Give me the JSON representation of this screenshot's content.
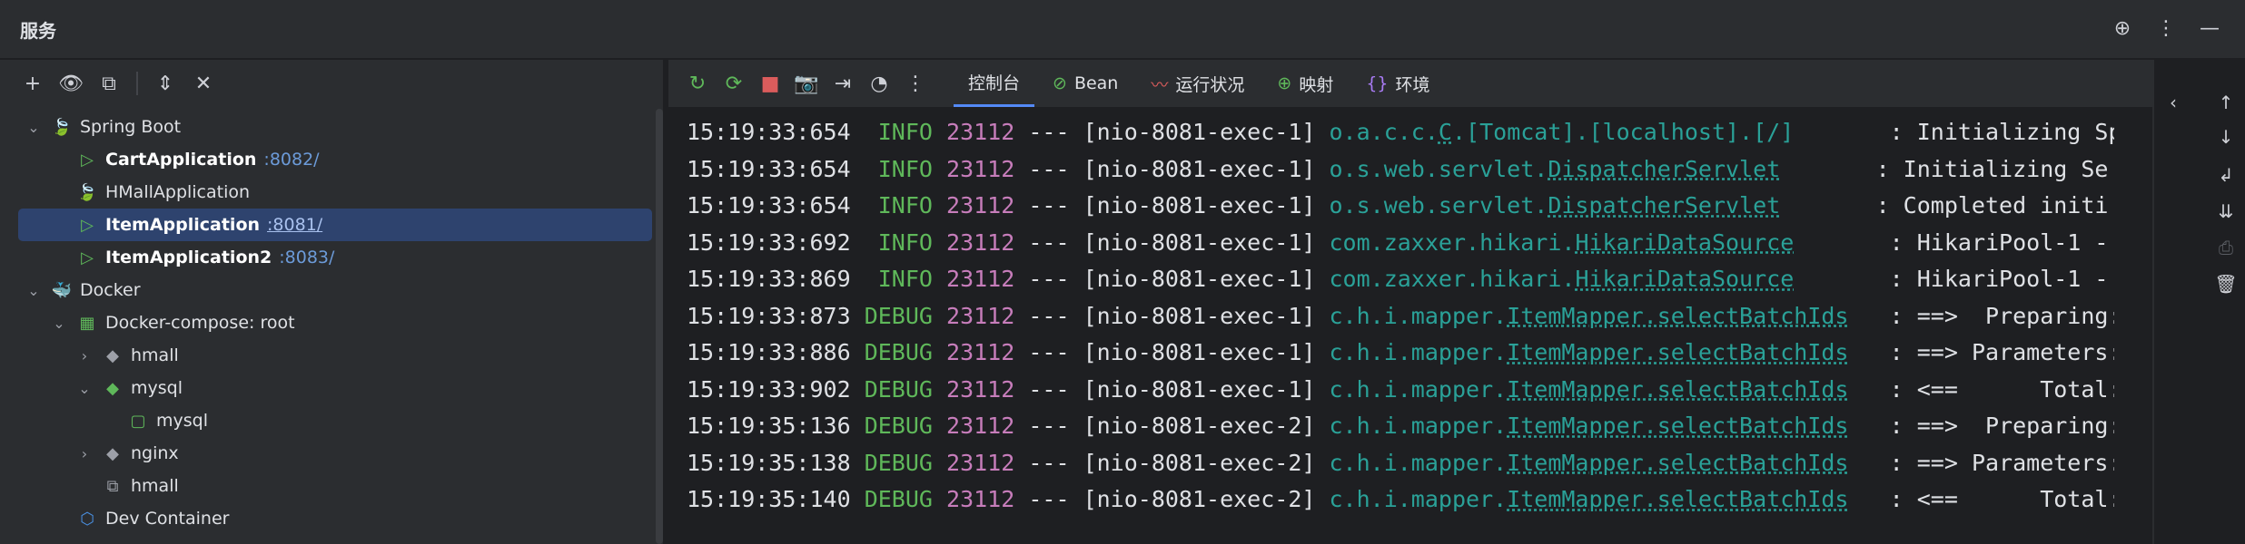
{
  "window": {
    "title": "服务"
  },
  "title_tools": [
    {
      "name": "target-icon",
      "glyph": "⊕"
    },
    {
      "name": "more-vertical-icon",
      "glyph": "⋮"
    },
    {
      "name": "minimize-icon",
      "glyph": "—"
    }
  ],
  "left_toolbar": [
    {
      "name": "add-icon",
      "glyph": "+"
    },
    {
      "name": "eye-icon",
      "glyph": "👁"
    },
    {
      "name": "new-tab-icon",
      "glyph": "⧉"
    },
    {
      "name": "expand-all-icon",
      "glyph": "⇕"
    },
    {
      "name": "collapse-all-icon",
      "glyph": "✕"
    }
  ],
  "tree": [
    {
      "label": "Spring Boot",
      "port": "",
      "indent": 0,
      "chevron": "⌄",
      "icon": "spring-boot-icon",
      "glyph": "🍃",
      "color": "#5fb85a",
      "bold": false,
      "selected": false
    },
    {
      "label": "CartApplication",
      "port": " :8082/",
      "indent": 1,
      "chevron": "",
      "icon": "run-icon",
      "glyph": "▷",
      "color": "#5fb85a",
      "bold": true,
      "selected": false
    },
    {
      "label": "HMallApplication",
      "port": "",
      "indent": 1,
      "chevron": "",
      "icon": "spring-boot-icon",
      "glyph": "🍃",
      "color": "#5fb85a",
      "bold": false,
      "selected": false
    },
    {
      "label": "ItemApplication",
      "port": " :8081/",
      "indent": 1,
      "chevron": "",
      "icon": "run-icon",
      "glyph": "▷",
      "color": "#5fb85a",
      "bold": true,
      "selected": true
    },
    {
      "label": "ItemApplication2",
      "port": " :8083/",
      "indent": 1,
      "chevron": "",
      "icon": "run-icon",
      "glyph": "▷",
      "color": "#5fb85a",
      "bold": true,
      "selected": false
    },
    {
      "label": "Docker",
      "port": "",
      "indent": 0,
      "chevron": "⌄",
      "icon": "docker-icon",
      "glyph": "🐳",
      "color": "#4a90e2",
      "bold": false,
      "selected": false
    },
    {
      "label": "Docker-compose: root",
      "port": "",
      "indent": 1,
      "chevron": "⌄",
      "icon": "compose-icon",
      "glyph": "▦",
      "color": "#5fb85a",
      "bold": false,
      "selected": false
    },
    {
      "label": "hmall",
      "port": "",
      "indent": 2,
      "chevron": "›",
      "icon": "service-icon",
      "glyph": "◆",
      "color": "#9da0a8",
      "bold": false,
      "selected": false
    },
    {
      "label": "mysql",
      "port": "",
      "indent": 2,
      "chevron": "⌄",
      "icon": "service-icon",
      "glyph": "◆",
      "color": "#5fb85a",
      "bold": false,
      "selected": false
    },
    {
      "label": "mysql",
      "port": "",
      "indent": 3,
      "chevron": "",
      "icon": "container-icon",
      "glyph": "▢",
      "color": "#5fb85a",
      "bold": false,
      "selected": false
    },
    {
      "label": "nginx",
      "port": "",
      "indent": 2,
      "chevron": "›",
      "icon": "service-icon",
      "glyph": "◆",
      "color": "#9da0a8",
      "bold": false,
      "selected": false
    },
    {
      "label": "hmall",
      "port": "",
      "indent": 2,
      "chevron": "",
      "icon": "network-icon",
      "glyph": "⧉",
      "color": "#9da0a8",
      "bold": false,
      "selected": false
    },
    {
      "label": "Dev Container",
      "port": "",
      "indent": 1,
      "chevron": "",
      "icon": "cube-icon",
      "glyph": "⬡",
      "color": "#4a90e2",
      "bold": false,
      "selected": false
    }
  ],
  "run_toolbar": [
    {
      "name": "rerun-icon",
      "glyph": "↻",
      "color": "#5fb85a"
    },
    {
      "name": "restart-icon",
      "glyph": "⟳",
      "color": "#5fb85a"
    },
    {
      "name": "stop-icon",
      "glyph": "■",
      "color": "#db5c5c"
    },
    {
      "name": "screenshot-icon",
      "glyph": "📷",
      "color": "#ced0d6"
    },
    {
      "name": "export-icon",
      "glyph": "⇥",
      "color": "#ced0d6"
    },
    {
      "name": "gauge-icon",
      "glyph": "◔",
      "color": "#ced0d6"
    },
    {
      "name": "more-vertical-icon",
      "glyph": "⋮",
      "color": "#ced0d6"
    }
  ],
  "tabs": [
    {
      "label": "控制台",
      "icon": "",
      "glyph": "",
      "color": "#dfe1e5",
      "active": true
    },
    {
      "label": "Bean",
      "icon": "bean-icon",
      "glyph": "⊘",
      "color": "#5fb85a",
      "active": false
    },
    {
      "label": "运行状况",
      "icon": "health-icon",
      "glyph": "〰",
      "color": "#db5c5c",
      "active": false
    },
    {
      "label": "映射",
      "icon": "globe-icon",
      "glyph": "⊕",
      "color": "#5fb85a",
      "active": false
    },
    {
      "label": "环境",
      "icon": "braces-icon",
      "glyph": "{}",
      "color": "#a97bf5",
      "active": false
    }
  ],
  "log_lines": [
    {
      "time": "15:19:33:654",
      "level": "INFO",
      "pid": "23112",
      "sep": "---",
      "thread": "[nio-8081-exec-1]",
      "pkg": "o.a.c.c.",
      "cls": "C",
      "rest": ".[Tomcat].[localhost].[/]      ",
      "msg": ": Initializing Sp"
    },
    {
      "time": "15:19:33:654",
      "level": "INFO",
      "pid": "23112",
      "sep": "---",
      "thread": "[nio-8081-exec-1]",
      "pkg": "o.s.web.servlet.",
      "cls": "DispatcherServlet",
      "rest": "      ",
      "msg": ": Initializing Se"
    },
    {
      "time": "15:19:33:654",
      "level": "INFO",
      "pid": "23112",
      "sep": "---",
      "thread": "[nio-8081-exec-1]",
      "pkg": "o.s.web.servlet.",
      "cls": "DispatcherServlet",
      "rest": "      ",
      "msg": ": Completed initi"
    },
    {
      "time": "15:19:33:692",
      "level": "INFO",
      "pid": "23112",
      "sep": "---",
      "thread": "[nio-8081-exec-1]",
      "pkg": "com.zaxxer.hikari.",
      "cls": "HikariDataSource",
      "rest": "      ",
      "msg": ": HikariPool-1 -"
    },
    {
      "time": "15:19:33:869",
      "level": "INFO",
      "pid": "23112",
      "sep": "---",
      "thread": "[nio-8081-exec-1]",
      "pkg": "com.zaxxer.hikari.",
      "cls": "HikariDataSource",
      "rest": "      ",
      "msg": ": HikariPool-1 -"
    },
    {
      "time": "15:19:33:873",
      "level": "DEBUG",
      "pid": "23112",
      "sep": "---",
      "thread": "[nio-8081-exec-1]",
      "pkg": "c.h.i.mapper.",
      "cls": "ItemMapper.selectBatchIds",
      "rest": "  ",
      "msg": ": ==>  Preparing:"
    },
    {
      "time": "15:19:33:886",
      "level": "DEBUG",
      "pid": "23112",
      "sep": "---",
      "thread": "[nio-8081-exec-1]",
      "pkg": "c.h.i.mapper.",
      "cls": "ItemMapper.selectBatchIds",
      "rest": "  ",
      "msg": ": ==> Parameters:"
    },
    {
      "time": "15:19:33:902",
      "level": "DEBUG",
      "pid": "23112",
      "sep": "---",
      "thread": "[nio-8081-exec-1]",
      "pkg": "c.h.i.mapper.",
      "cls": "ItemMapper.selectBatchIds",
      "rest": "  ",
      "msg": ": <==      Total:"
    },
    {
      "time": "15:19:35:136",
      "level": "DEBUG",
      "pid": "23112",
      "sep": "---",
      "thread": "[nio-8081-exec-2]",
      "pkg": "c.h.i.mapper.",
      "cls": "ItemMapper.selectBatchIds",
      "rest": "  ",
      "msg": ": ==>  Preparing:"
    },
    {
      "time": "15:19:35:138",
      "level": "DEBUG",
      "pid": "23112",
      "sep": "---",
      "thread": "[nio-8081-exec-2]",
      "pkg": "c.h.i.mapper.",
      "cls": "ItemMapper.selectBatchIds",
      "rest": "  ",
      "msg": ": ==> Parameters:"
    },
    {
      "time": "15:19:35:140",
      "level": "DEBUG",
      "pid": "23112",
      "sep": "---",
      "thread": "[nio-8081-exec-2]",
      "pkg": "c.h.i.mapper.",
      "cls": "ItemMapper.selectBatchIds",
      "rest": "  ",
      "msg": ": <==      Total:"
    }
  ],
  "console_side": [
    {
      "name": "collapse-panel-icon",
      "glyph": "‹",
      "dim": false
    },
    {
      "name": "scroll-up-icon",
      "glyph": "↑",
      "dim": false
    },
    {
      "name": "scroll-down-icon",
      "glyph": "↓",
      "dim": false
    },
    {
      "name": "soft-wrap-icon",
      "glyph": "↲",
      "dim": false
    },
    {
      "name": "scroll-to-end-icon",
      "glyph": "⇊",
      "dim": false
    },
    {
      "name": "print-icon",
      "glyph": "⎙",
      "dim": true
    },
    {
      "name": "trash-icon",
      "glyph": "🗑",
      "dim": false
    }
  ]
}
